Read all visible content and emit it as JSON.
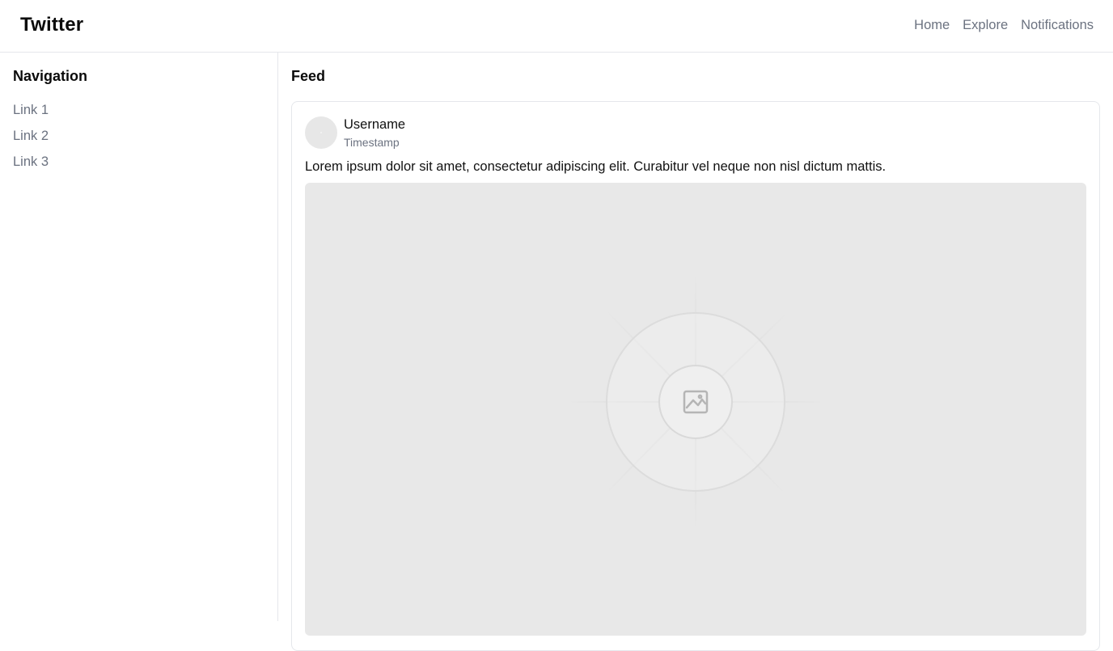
{
  "header": {
    "brand": "Twitter",
    "nav": [
      "Home",
      "Explore",
      "Notifications"
    ]
  },
  "sidebar": {
    "title": "Navigation",
    "links": [
      "Link 1",
      "Link 2",
      "Link 3"
    ]
  },
  "feed": {
    "title": "Feed",
    "post": {
      "username": "Username",
      "timestamp": "Timestamp",
      "text": "Lorem ipsum dolor sit amet, consectetur adipiscing elit. Curabitur vel neque non nisl dictum mattis.",
      "media_icon": "image-placeholder-icon"
    }
  },
  "colors": {
    "muted_text": "#6b7280",
    "border": "#e5e7eb",
    "placeholder_bg": "#e8e8e8"
  }
}
